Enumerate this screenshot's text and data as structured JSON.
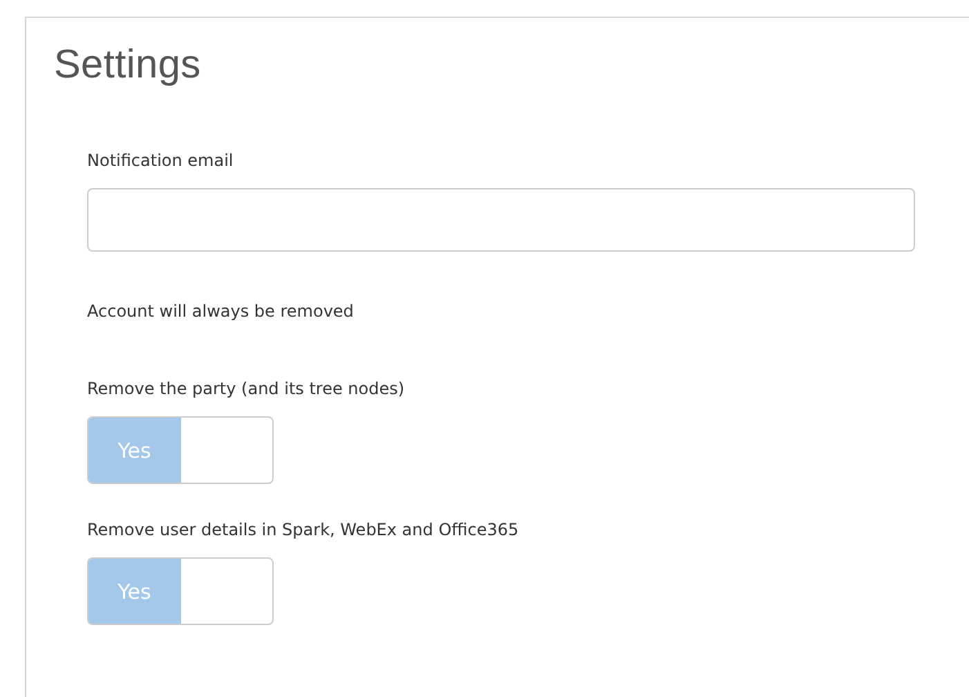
{
  "title": "Settings",
  "email": {
    "label": "Notification email"
  },
  "note": "Account will always be removed",
  "toggles": [
    {
      "label": "Remove the party (and its tree nodes)",
      "text": "Yes",
      "on": true
    },
    {
      "label": "Remove user details in Spark, WebEx and Office365",
      "text": "Yes",
      "on": true
    }
  ]
}
